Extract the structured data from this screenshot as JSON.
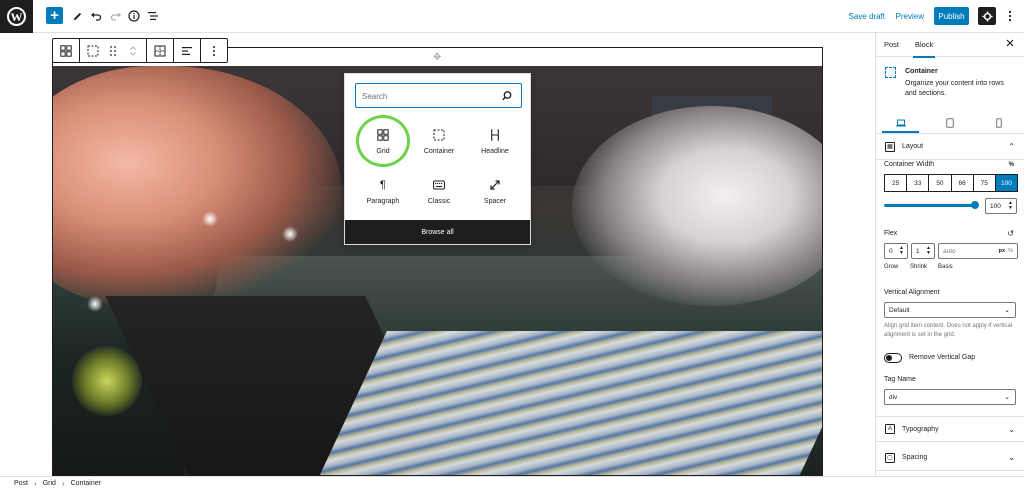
{
  "toolbar": {
    "add_label": "+",
    "save_draft": "Save draft",
    "preview": "Preview",
    "publish": "Publish"
  },
  "block_toolbar": {
    "icons": [
      "grid-icon",
      "container-icon",
      "drag-icon",
      "move-icon",
      "select-parent-icon",
      "align-icon",
      "more-icon"
    ]
  },
  "inserter": {
    "search_placeholder": "Search",
    "items": [
      {
        "label": "Grid",
        "icon": "grid-icon",
        "highlighted": true
      },
      {
        "label": "Container",
        "icon": "container-icon"
      },
      {
        "label": "Headline",
        "icon": "headline-icon"
      },
      {
        "label": "Paragraph",
        "icon": "paragraph-icon"
      },
      {
        "label": "Classic",
        "icon": "keyboard-icon"
      },
      {
        "label": "Spacer",
        "icon": "spacer-icon"
      }
    ],
    "browse_all": "Browse all",
    "highlight_color": "#6ed14a"
  },
  "breadcrumb": {
    "items": [
      "Post",
      "Grid",
      "Container"
    ]
  },
  "sidebar": {
    "tabs": [
      "Post",
      "Block"
    ],
    "active_tab": "Block",
    "block": {
      "title": "Container",
      "description": "Organize your content into rows and sections."
    },
    "layout": {
      "title": "Layout",
      "container_width_label": "Container Width",
      "unit": "%",
      "width_options": [
        "25",
        "33",
        "50",
        "66",
        "75",
        "100"
      ],
      "active_width": "100",
      "width_value": "100",
      "flex_label": "Flex",
      "flex_grow": "0",
      "flex_shrink": "1",
      "flex_basis_placeholder": "auto",
      "flex_basis_units": "px",
      "flex_basis_unit2": "%",
      "grow_label": "Grow",
      "shrink_label": "Shrink",
      "basis_label": "Basis",
      "vertical_alignment_label": "Vertical Alignment",
      "vertical_alignment_value": "Default",
      "vertical_alignment_help": "Align grid item content. Does not apply if vertical alignment is set in the grid.",
      "remove_gap_label": "Remove Vertical Gap",
      "tag_name_label": "Tag Name",
      "tag_name_value": "div"
    },
    "typography_title": "Typography",
    "spacing_title": "Spacing"
  },
  "colors": {
    "accent": "#007cba",
    "dark": "#1e1e1e"
  }
}
